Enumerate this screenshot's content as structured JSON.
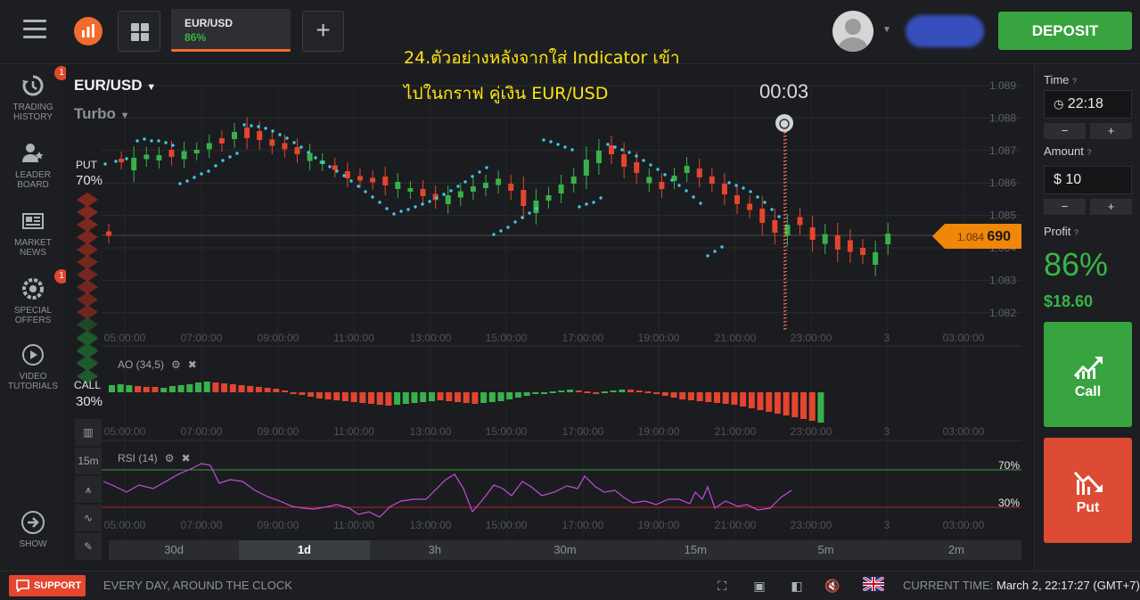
{
  "header": {
    "asset_tab": {
      "name": "EUR/USD",
      "payout": "86%"
    },
    "add_label": "+",
    "deposit_label": "DEPOSIT"
  },
  "sidebar": {
    "items": [
      {
        "label": "TRADING HISTORY",
        "icon": "history-icon",
        "badge": "1"
      },
      {
        "label": "LEADER BOARD",
        "icon": "leaderboard-icon"
      },
      {
        "label": "MARKET NEWS",
        "icon": "news-icon"
      },
      {
        "label": "SPECIAL OFFERS",
        "icon": "offers-icon",
        "badge": "1"
      },
      {
        "label": "VIDEO TUTORIALS",
        "icon": "play-icon"
      }
    ],
    "show_label": "SHOW"
  },
  "chart": {
    "pair": "EUR/USD",
    "mode": "Turbo",
    "caption_line1": "24.ตัวอย่างหลังจากใส่ Indicator เข้า",
    "caption_line2": "ไปในกราฟ คู่เงิน EUR/USD",
    "timer": "00:03",
    "put_label": "PUT",
    "put_pct": "70%",
    "call_label": "CALL",
    "call_pct": "30%",
    "price_small": "1.084",
    "price_big": "690",
    "ao_label": "AO (34,5)",
    "rsi_label": "RSI (14)",
    "rsi_upper": "70%",
    "rsi_lower": "30%",
    "interval_label": "15m",
    "periods": [
      "30d",
      "1d",
      "3h",
      "30m",
      "15m",
      "5m",
      "2m"
    ],
    "active_period": "1d"
  },
  "chart_data": {
    "type": "candlestick",
    "price_ticks": [
      "1.089",
      "1.088",
      "1.087",
      "1.086",
      "1.085",
      "1.084",
      "1.083",
      "1.082"
    ],
    "time_ticks": [
      "05:00:00",
      "07:00:00",
      "09:00:00",
      "11:00:00",
      "13:00:00",
      "15:00:00",
      "17:00:00",
      "19:00:00",
      "21:00:00",
      "23:00:00",
      "3",
      "03:00:00"
    ],
    "current_price": 1.08469,
    "rsi_levels": [
      70,
      30
    ]
  },
  "right_panel": {
    "time_label": "Time",
    "time_value": "22:18",
    "amount_label": "Amount",
    "amount_value": "$ 10",
    "minus": "−",
    "plus": "+",
    "profit_label": "Profit",
    "profit_pct": "86%",
    "profit_amount": "$18.60",
    "call_label": "Call",
    "put_label": "Put"
  },
  "footer": {
    "support_label": "SUPPORT",
    "tagline": "EVERY DAY, AROUND THE CLOCK",
    "current_time_label": "CURRENT TIME:",
    "current_time_value": "March 2, 22:17:27",
    "timezone": "(GMT+7)"
  },
  "colors": {
    "up": "#39b14a",
    "down": "#e3452e",
    "accent": "#f26b2a",
    "sar": "#3ec7f0",
    "rsi": "#c04fd8",
    "caption": "#ffe414"
  }
}
